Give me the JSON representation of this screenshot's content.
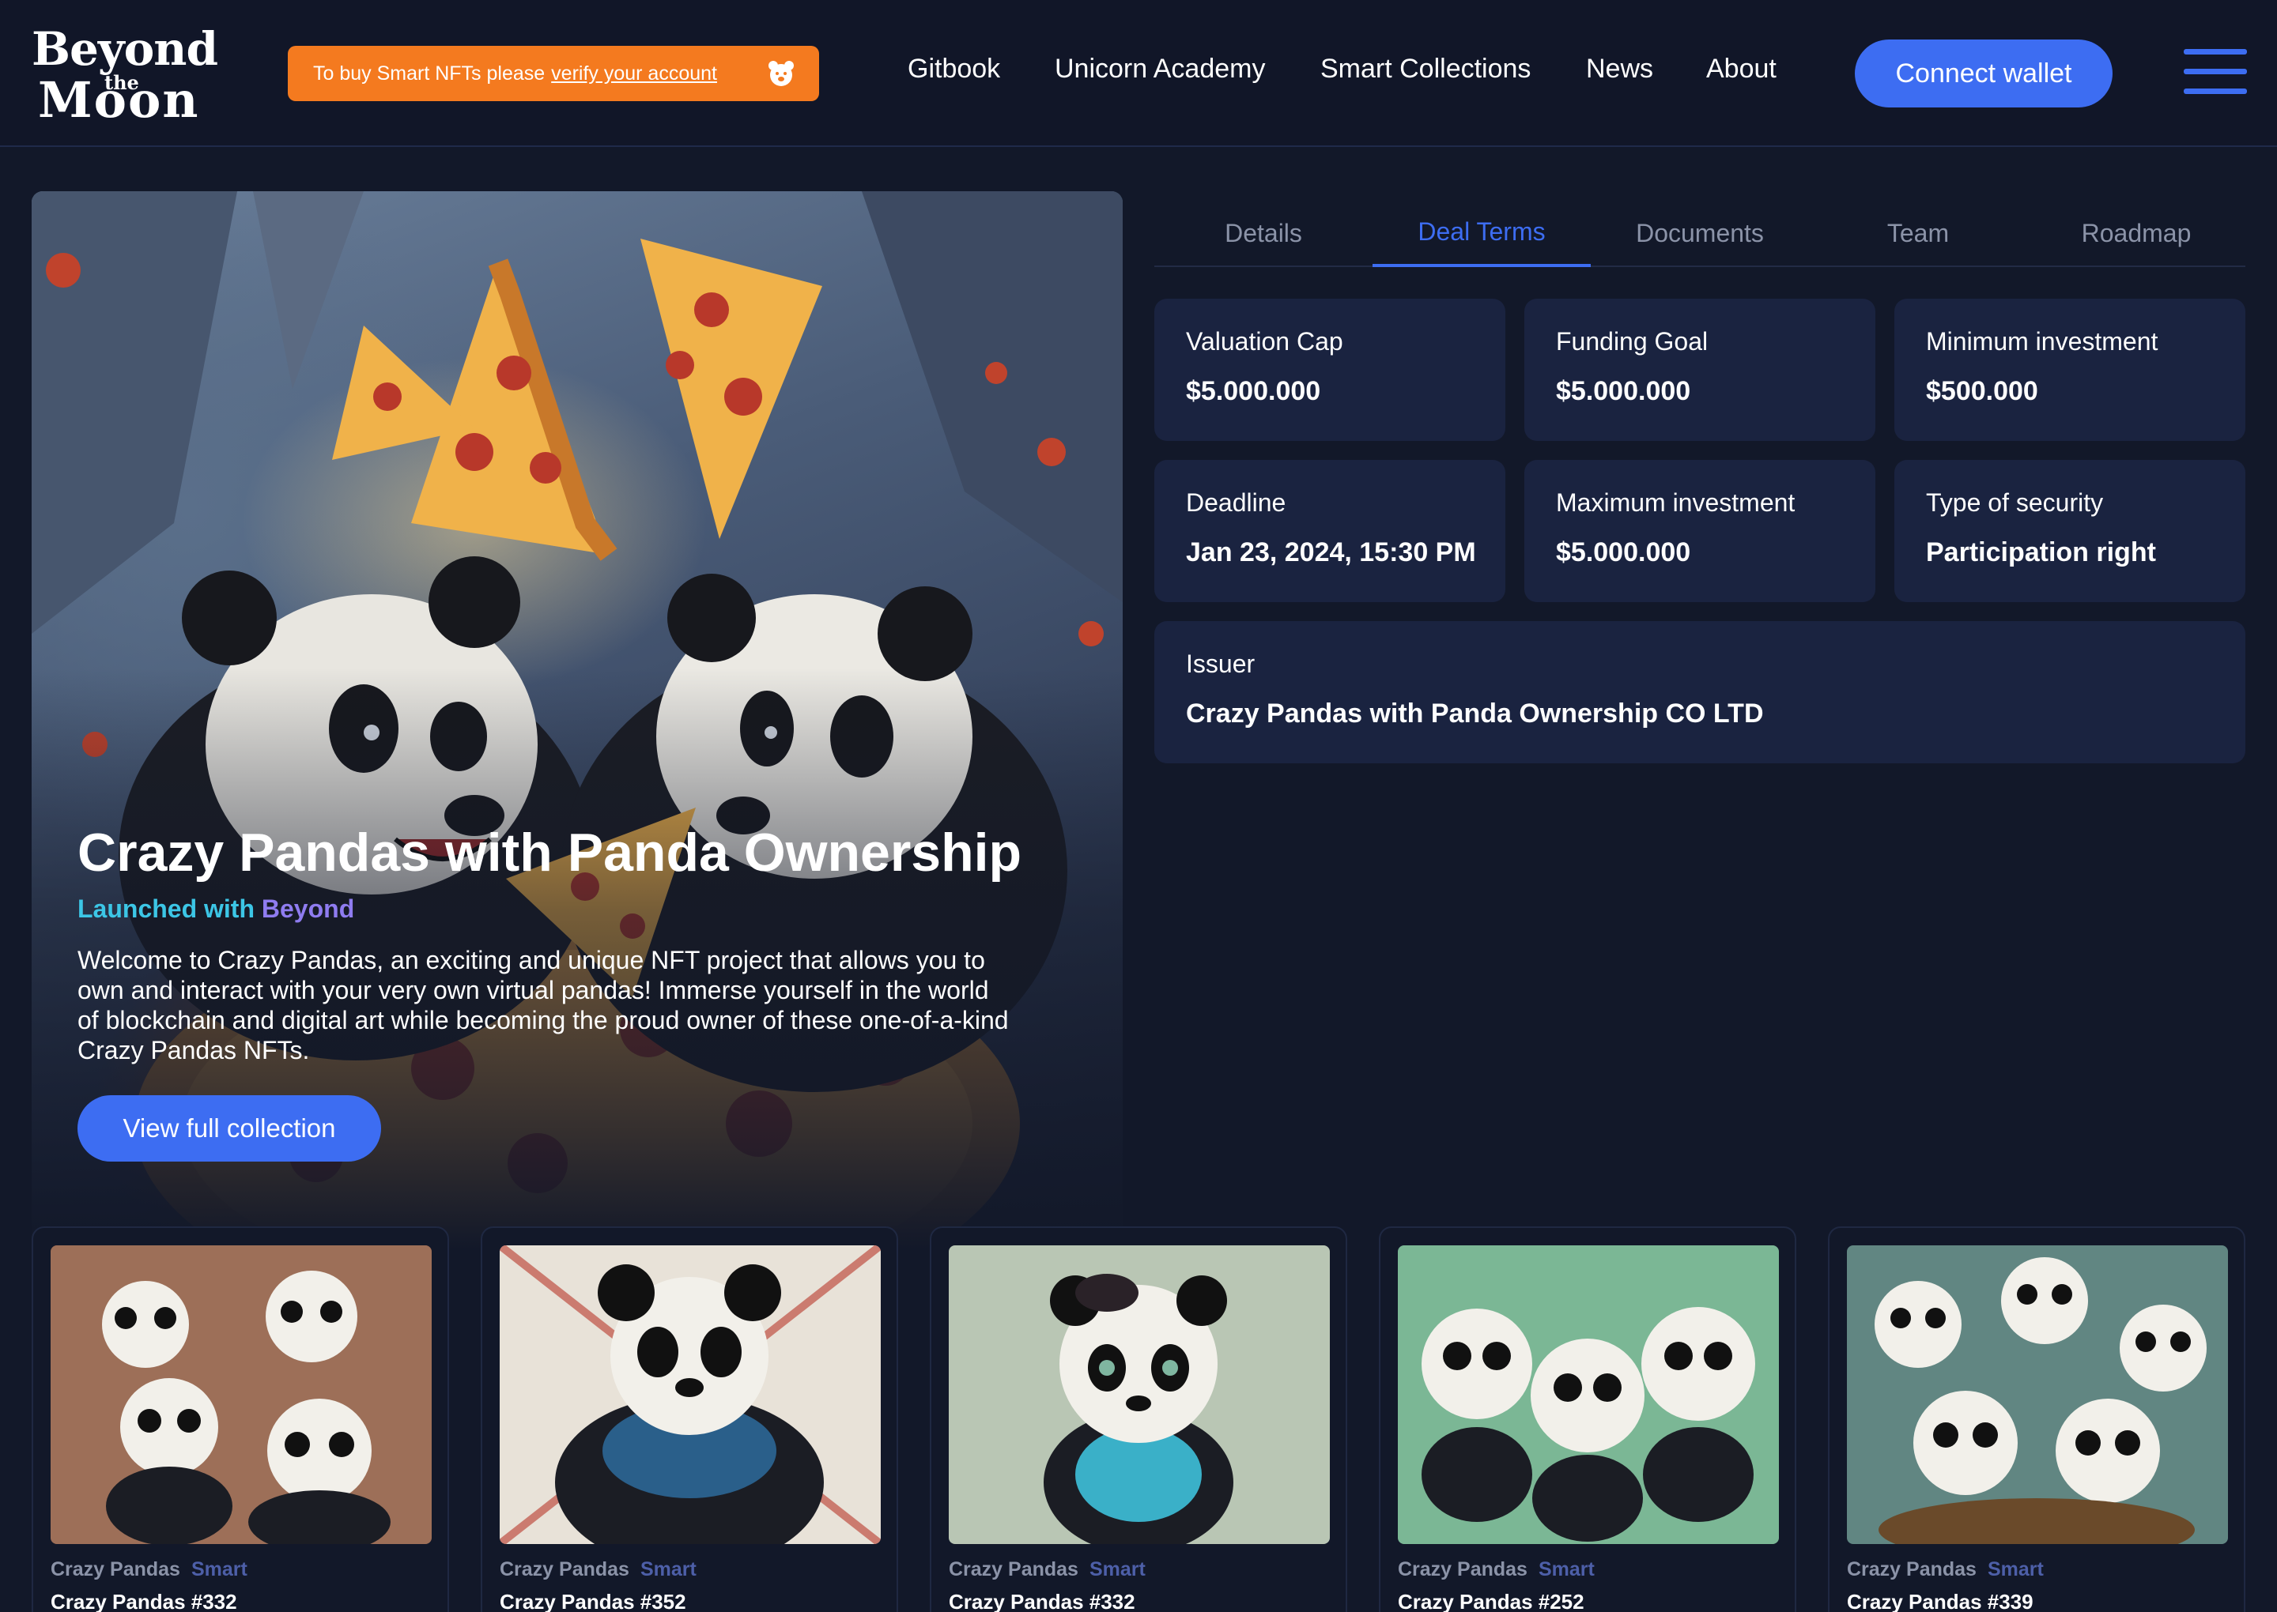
{
  "header": {
    "logo": {
      "line1": "Beyond",
      "line2": "the",
      "line3": "Moon"
    },
    "notice": {
      "text": "To buy Smart NFTs please",
      "link": "verify your account",
      "icon": "bear-icon"
    },
    "nav": [
      {
        "label": "Gitbook"
      },
      {
        "label": "Unicorn Academy"
      },
      {
        "label": "Smart Collections"
      },
      {
        "label": "News"
      },
      {
        "label": "About"
      }
    ],
    "connect_label": "Connect wallet",
    "menu_icon": "hamburger-menu-icon"
  },
  "hero": {
    "title": "Crazy Pandas with Panda Ownership",
    "launched_prefix": "Launched with",
    "launched_brand": "Beyond",
    "description": "Welcome to Crazy Pandas, an exciting and unique NFT project that allows you to own and interact with your very own virtual pandas! Immerse yourself in the world of blockchain and digital art while becoming the proud owner of these one-of-a-kind Crazy Pandas NFTs.",
    "button": "View full collection"
  },
  "tabs": [
    {
      "label": "Details"
    },
    {
      "label": "Deal Terms",
      "active": true
    },
    {
      "label": "Documents"
    },
    {
      "label": "Team"
    },
    {
      "label": "Roadmap"
    }
  ],
  "deal_terms": {
    "valuation_cap": {
      "label": "Valuation Cap",
      "value": "$5.000.000"
    },
    "funding_goal": {
      "label": "Funding Goal",
      "value": "$5.000.000"
    },
    "minimum_investment": {
      "label": "Minimum investment",
      "value": "$500.000"
    },
    "deadline": {
      "label": "Deadline",
      "value": "Jan 23, 2024, 15:30 PM"
    },
    "maximum_investment": {
      "label": "Maximum investment",
      "value": "$5.000.000"
    },
    "type_of_security": {
      "label": "Type of security",
      "value": "Participation right"
    },
    "issuer": {
      "label": "Issuer",
      "value": "Crazy Pandas with Panda Ownership CO LTD"
    }
  },
  "nfts": [
    {
      "collection": "Crazy Pandas",
      "tag": "Smart",
      "name": "Crazy Pandas #332"
    },
    {
      "collection": "Crazy Pandas",
      "tag": "Smart",
      "name": "Crazy Pandas #352"
    },
    {
      "collection": "Crazy Pandas",
      "tag": "Smart",
      "name": "Crazy Pandas #332"
    },
    {
      "collection": "Crazy Pandas",
      "tag": "Smart",
      "name": "Crazy Pandas #252"
    },
    {
      "collection": "Crazy Pandas",
      "tag": "Smart",
      "name": "Crazy Pandas #339"
    }
  ],
  "colors": {
    "background": "#121829",
    "card": "#1a2340",
    "accent": "#3d6df2",
    "notice": "#f47a1f",
    "launched": "#3cc6e6",
    "brand": "#8f7cf0"
  }
}
